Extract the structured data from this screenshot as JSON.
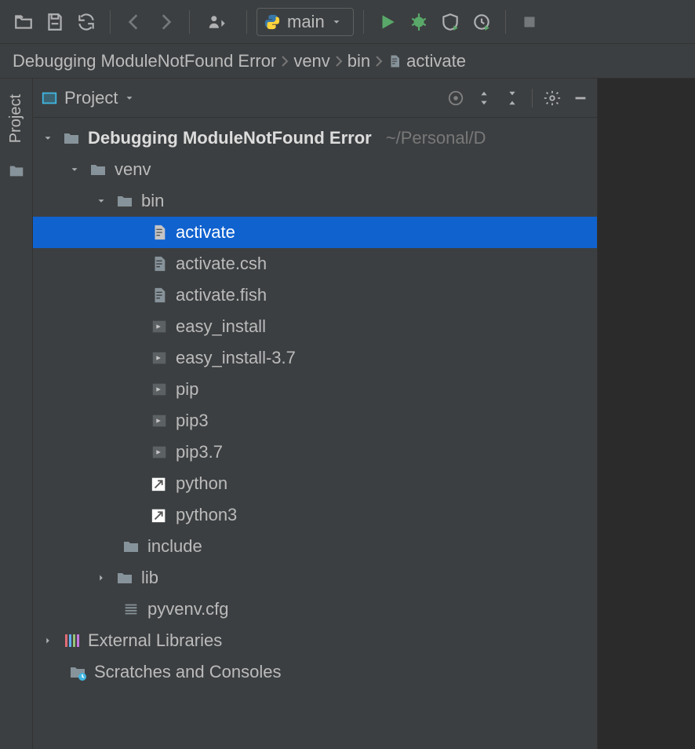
{
  "toolbar": {
    "run_config_label": "main"
  },
  "breadcrumb": {
    "items": [
      "Debugging ModuleNotFound Error",
      "venv",
      "bin",
      "activate"
    ]
  },
  "panel": {
    "title": "Project"
  },
  "sidetab": {
    "label": "Project"
  },
  "tree": {
    "root": {
      "name": "Debugging ModuleNotFound Error",
      "hint": "~/Personal/D"
    },
    "venv": "venv",
    "bin": "bin",
    "files": {
      "activate": "activate",
      "activate_csh": "activate.csh",
      "activate_fish": "activate.fish",
      "easy_install": "easy_install",
      "easy_install_37": "easy_install-3.7",
      "pip": "pip",
      "pip3": "pip3",
      "pip37": "pip3.7",
      "python": "python",
      "python3": "python3"
    },
    "include": "include",
    "lib": "lib",
    "pyvenv": "pyvenv.cfg",
    "ext_lib": "External Libraries",
    "scratches": "Scratches and Consoles"
  }
}
